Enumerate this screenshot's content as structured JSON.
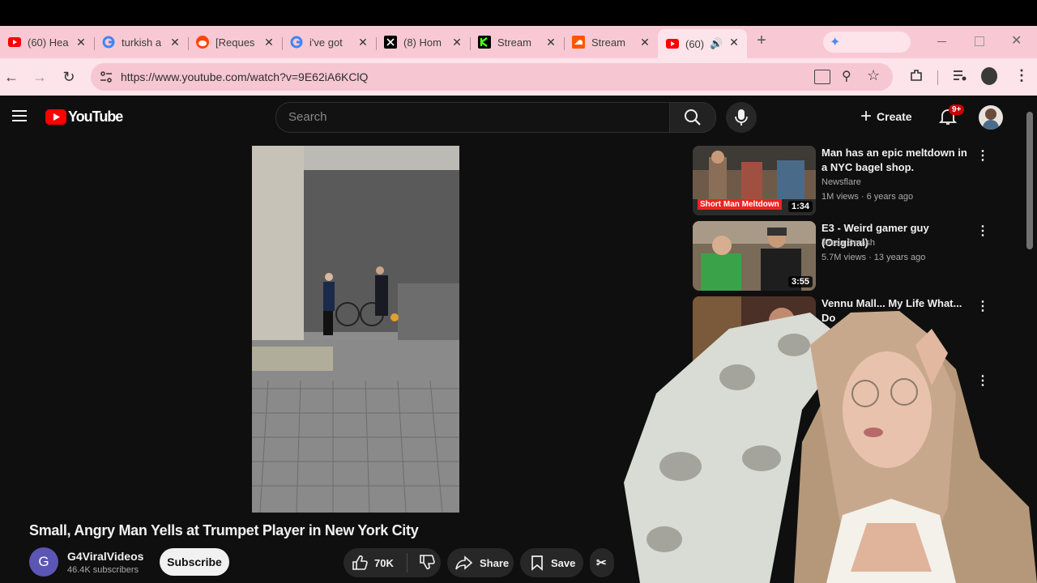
{
  "browser": {
    "tabs": [
      {
        "title": "(60) Hea",
        "icon": "youtube-icon"
      },
      {
        "title": "turkish a",
        "icon": "google-icon"
      },
      {
        "title": "[Reques",
        "icon": "reddit-icon"
      },
      {
        "title": "i've got",
        "icon": "google-icon"
      },
      {
        "title": "(8) Hom",
        "icon": "x-icon"
      },
      {
        "title": "Stream",
        "icon": "kick-icon"
      },
      {
        "title": "Stream",
        "icon": "soundcloud-icon"
      },
      {
        "title": "(60)",
        "icon": "youtube-icon",
        "active": true
      }
    ],
    "url": "https://www.youtube.com/watch?v=9E62iA6KClQ"
  },
  "youtube": {
    "logo_text": "YouTube",
    "search_placeholder": "Search",
    "create_label": "Create",
    "notifications_badge": "9+",
    "video": {
      "title": "Small, Angry Man Yells at Trumpet Player in New York City",
      "channel": "G4ViralVideos",
      "channel_initial": "G",
      "subscribers": "46.4K subscribers",
      "subscribe_label": "Subscribe",
      "likes": "70K",
      "share_label": "Share",
      "save_label": "Save"
    },
    "recommendations": [
      {
        "title": "Man has an epic meltdown in a NYC bagel shop.",
        "channel": "Newsflare",
        "meta": "1M views · 6 years ago",
        "duration": "1:34",
        "overlay": "Short Man Meltdown"
      },
      {
        "title": "E3 - Weird gamer guy (Original)",
        "channel": "Tessa Smash",
        "meta": "5.7M views · 13 years ago",
        "duration": "3:55"
      },
      {
        "title": "Vennu Mall... My Life What... Do",
        "channel": "",
        "meta": "",
        "duration": ""
      }
    ]
  },
  "colors": {
    "tabstrip": "#f8c9d4",
    "yt_background": "#0f0f0f",
    "yt_red": "#ff0000"
  }
}
